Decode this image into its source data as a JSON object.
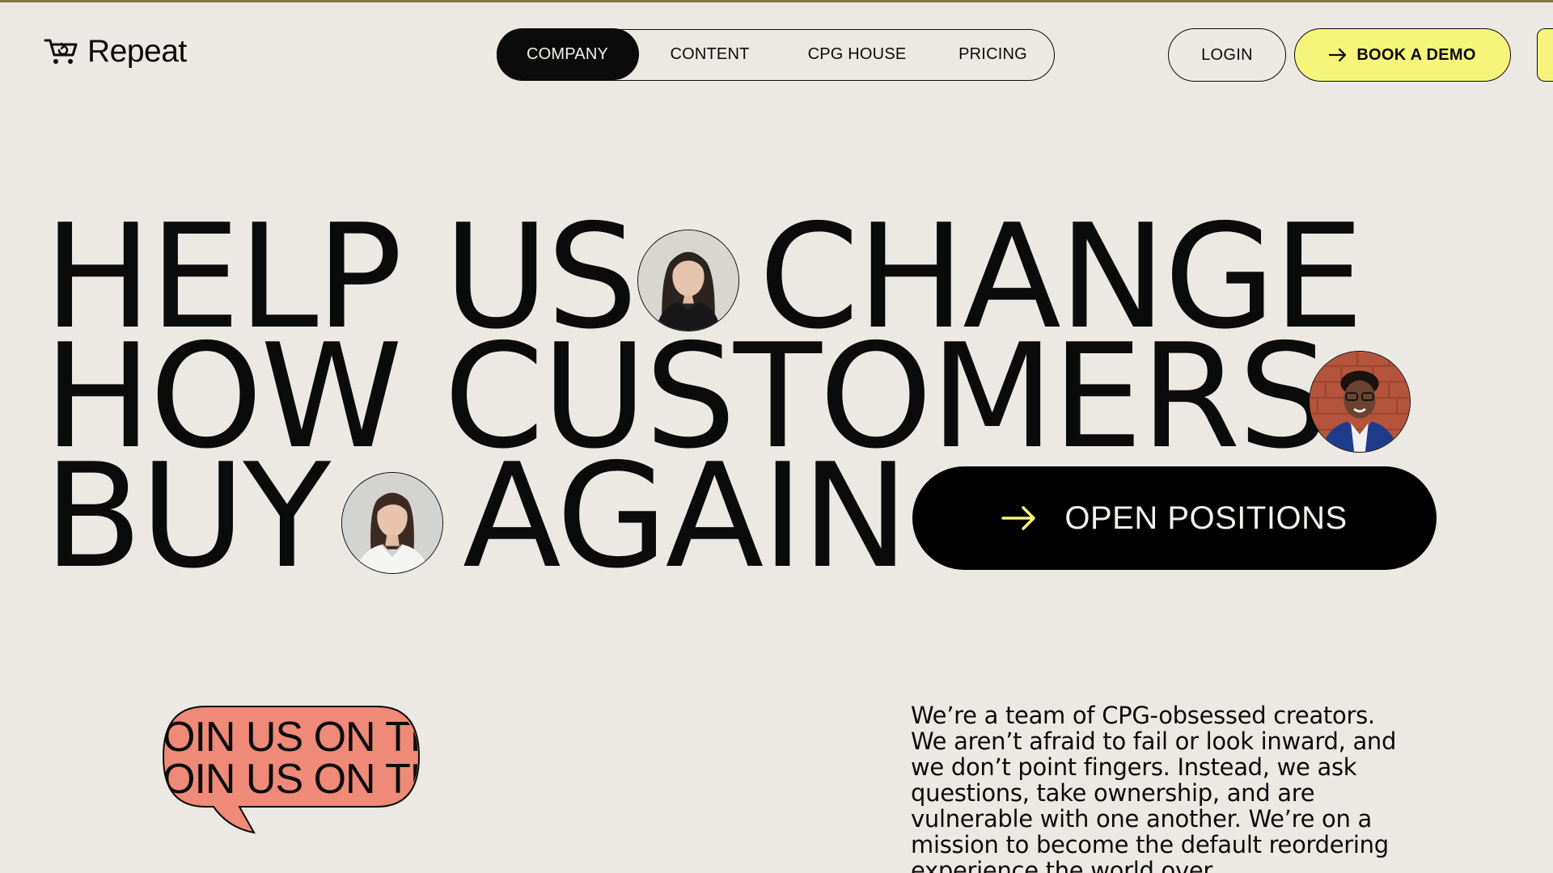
{
  "header": {
    "logo_text": "Repeat",
    "nav": {
      "items": [
        {
          "label": "COMPANY",
          "active": true
        },
        {
          "label": "CONTENT",
          "active": false
        },
        {
          "label": "CPG HOUSE",
          "active": false
        },
        {
          "label": "PRICING",
          "active": false
        }
      ]
    },
    "login_label": "LOGIN",
    "demo_label": "BOOK A DEMO"
  },
  "hero": {
    "line1_a": "HELP US",
    "line1_b": "CHANGE",
    "line2_a": "HOW CUSTOMERS",
    "line3_a": "BUY",
    "line3_b": "AGAIN",
    "open_positions_label": "OPEN POSITIONS"
  },
  "bubble": {
    "line1": "JOIN US ON TH",
    "line2": "JOIN US ON TH"
  },
  "mission_text": "We’re a team of CPG-obsessed creators. We aren’t afraid to fail or look inward, and we don’t point fingers. Instead, we ask questions, take ownership, and are vulnerable with one another. We’re on a mission to become the default reordering experience the world over.",
  "colors": {
    "background": "#ece8e3",
    "accent_yellow": "#f6f57b",
    "bubble_coral": "#ee8a77",
    "ink": "#0b0b0b"
  },
  "icons": {
    "logo": "cart-repeat-icon",
    "demo_arrow": "arrow-right-icon",
    "open_arrow": "arrow-right-icon"
  }
}
